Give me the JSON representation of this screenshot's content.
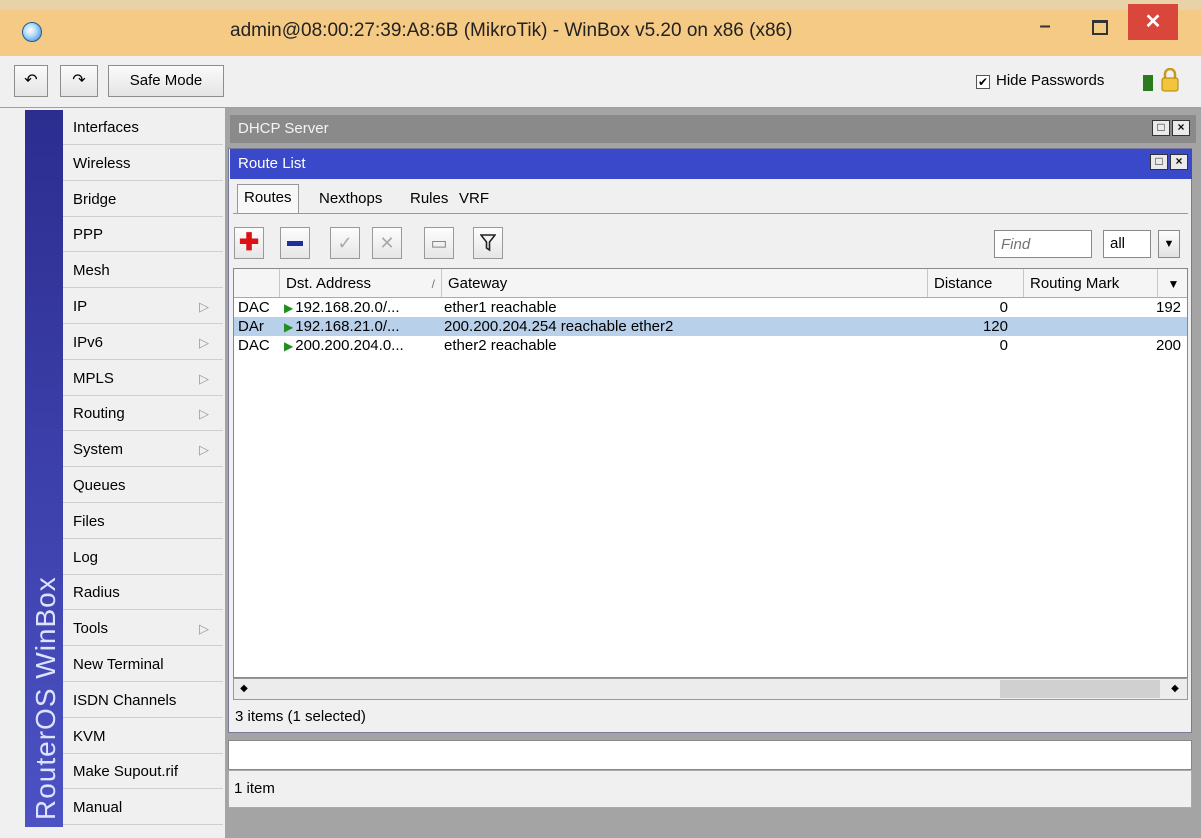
{
  "window": {
    "title": "admin@08:00:27:39:A8:6B (MikroTik) - WinBox v5.20 on x86 (x86)",
    "minimize_glyph": "–",
    "close_glyph": "✕"
  },
  "toolbar": {
    "undo_glyph": "↶",
    "redo_glyph": "↷",
    "safe_mode_label": "Safe Mode",
    "hide_passwords_label": "Hide Passwords",
    "hide_passwords_checked": "✔"
  },
  "sidebar": {
    "brand": "RouterOS WinBox",
    "items": [
      {
        "label": "Interfaces",
        "submenu": false
      },
      {
        "label": "Wireless",
        "submenu": false
      },
      {
        "label": "Bridge",
        "submenu": false
      },
      {
        "label": "PPP",
        "submenu": false
      },
      {
        "label": "Mesh",
        "submenu": false
      },
      {
        "label": "IP",
        "submenu": true
      },
      {
        "label": "IPv6",
        "submenu": true
      },
      {
        "label": "MPLS",
        "submenu": true
      },
      {
        "label": "Routing",
        "submenu": true
      },
      {
        "label": "System",
        "submenu": true
      },
      {
        "label": "Queues",
        "submenu": false
      },
      {
        "label": "Files",
        "submenu": false
      },
      {
        "label": "Log",
        "submenu": false
      },
      {
        "label": "Radius",
        "submenu": false
      },
      {
        "label": "Tools",
        "submenu": true
      },
      {
        "label": "New Terminal",
        "submenu": false
      },
      {
        "label": "ISDN Channels",
        "submenu": false
      },
      {
        "label": "KVM",
        "submenu": false
      },
      {
        "label": "Make Supout.rif",
        "submenu": false
      },
      {
        "label": "Manual",
        "submenu": false
      }
    ],
    "submenu_arrow": "▷"
  },
  "dhcp_window": {
    "title": "DHCP Server",
    "status": "1 item"
  },
  "route_window": {
    "title": "Route List",
    "tabs": [
      "Routes",
      "Nexthops",
      "Rules",
      "VRF"
    ],
    "find_placeholder": "Find",
    "filter_value": "all",
    "columns": [
      "Dst. Address",
      "Gateway",
      "Distance",
      "Routing Mark"
    ],
    "sort_glyph": "/",
    "rows": [
      {
        "flags": "DAC",
        "dst": "192.168.20.0/...",
        "gateway": "ether1 reachable",
        "distance": "0",
        "mark": "",
        "extra": "192",
        "selected": false
      },
      {
        "flags": "DAr",
        "dst": "192.168.21.0/...",
        "gateway": "200.200.204.254 reachable ether2",
        "distance": "120",
        "mark": "",
        "extra": "",
        "selected": true
      },
      {
        "flags": "DAC",
        "dst": "200.200.204.0...",
        "gateway": "ether2 reachable",
        "distance": "0",
        "mark": "",
        "extra": "200",
        "selected": false
      }
    ],
    "status": "3 items (1 selected)"
  },
  "colors": {
    "title_bar": "#f5ca84",
    "route_title": "#3949c9",
    "selection": "#b9d0ea",
    "close_button": "#d9463b"
  }
}
